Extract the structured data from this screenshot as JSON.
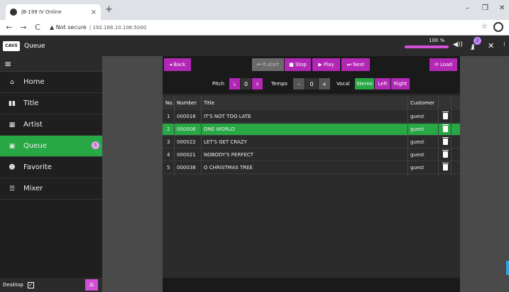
{
  "browser": {
    "tab_title": "JB-199 IV Online",
    "tab_close": "×",
    "new_tab": "+",
    "back": "←",
    "forward": "→",
    "reload": "C",
    "security": "▲ Not secure",
    "url": "| 192.168.10.106:5000",
    "star": "☆",
    "min": "–",
    "max": "❐",
    "close": "✕"
  },
  "app": {
    "logo_text": "CAVS",
    "title": "Queue",
    "volume_label": "100 %",
    "volume_fraction": 1.0,
    "signal_badge": "2"
  },
  "sidebar": {
    "menu_icon": "≡",
    "items": [
      {
        "label": "Home",
        "icon": "home-icon",
        "glyph": "⌂"
      },
      {
        "label": "Title",
        "icon": "book-icon",
        "glyph": "▮▮"
      },
      {
        "label": "Artist",
        "icon": "table-icon",
        "glyph": "▦"
      },
      {
        "label": "Queue",
        "icon": "clipboard-icon",
        "glyph": "▣",
        "badge": "5"
      },
      {
        "label": "Favorite",
        "icon": "users-icon",
        "glyph": "☻"
      },
      {
        "label": "Mixer",
        "icon": "sliders-icon",
        "glyph": "☰"
      }
    ],
    "footer_label": "Desktop",
    "checkbox": "✓",
    "home_glyph": "⌂"
  },
  "controls": {
    "back": "◂ Back",
    "rstart": "⏮ R.start",
    "stop": "■ Stop",
    "play": "▶ Play",
    "next": "⏭ Next",
    "load": "⟳ Load"
  },
  "pitch": {
    "pitch_label": "Pitch",
    "flat": "♭",
    "pitch_value": "0",
    "sharp": "♯",
    "tempo_label": "Tempo",
    "tempo_minus": "–",
    "tempo_value": "0",
    "tempo_plus": "+",
    "vocal_label": "Vocal",
    "stereo": "Stereo",
    "left": "Left",
    "right": "Right"
  },
  "table": {
    "headers": {
      "no": "No.",
      "number": "Number",
      "title": "Title",
      "customer": "Customer"
    },
    "rows": [
      {
        "no": "1",
        "number": "000016",
        "title": "IT'S NOT TOO LATE",
        "customer": "guest"
      },
      {
        "no": "2",
        "number": "000006",
        "title": "ONE WORLD",
        "customer": "guest"
      },
      {
        "no": "3",
        "number": "000022",
        "title": "LET'S GET CRAZY",
        "customer": "guest"
      },
      {
        "no": "4",
        "number": "000021",
        "title": "NOBODY'S PERFECT",
        "customer": "guest"
      },
      {
        "no": "5",
        "number": "000038",
        "title": "O CHRISTMAS TREE",
        "customer": "guest"
      }
    ]
  },
  "colors": {
    "accent": "#b227b5",
    "active": "#28a745",
    "dark": "#2b2b2b"
  }
}
